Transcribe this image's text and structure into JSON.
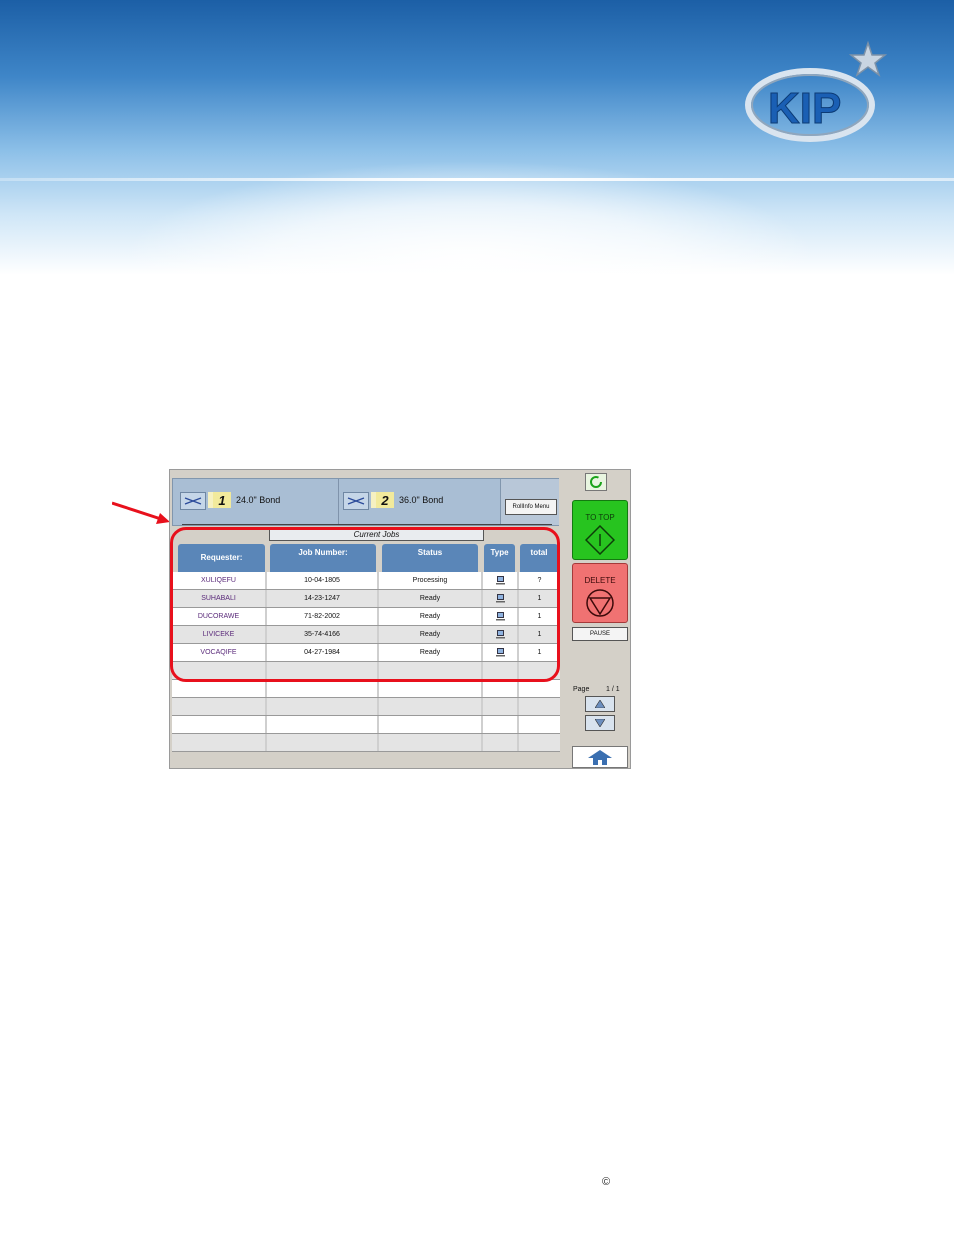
{
  "logo": {
    "text": "KIP"
  },
  "rolls": [
    {
      "number": "1",
      "label": "24.0\" Bond"
    },
    {
      "number": "2",
      "label": "36.0\" Bond"
    }
  ],
  "roll_info_label": "RollInfo Menu",
  "section_title": "Current Jobs",
  "columns": [
    "Requester:",
    "Job Number:",
    "Status",
    "Type",
    "total"
  ],
  "jobs": [
    {
      "requester": "XULIQEFU",
      "job_number": "10-04-1805",
      "status": "Processing",
      "type_icon": "computer-icon",
      "total": "?"
    },
    {
      "requester": "SUHABALI",
      "job_number": "14-23-1247",
      "status": "Ready",
      "type_icon": "computer-icon",
      "total": "1"
    },
    {
      "requester": "DUCORAWE",
      "job_number": "71-82-2002",
      "status": "Ready",
      "type_icon": "computer-icon",
      "total": "1"
    },
    {
      "requester": "LIVICEKE",
      "job_number": "35-74-4166",
      "status": "Ready",
      "type_icon": "computer-icon",
      "total": "1"
    },
    {
      "requester": "VOCAQIFE",
      "job_number": "04-27-1984",
      "status": "Ready",
      "type_icon": "computer-icon",
      "total": "1"
    }
  ],
  "side_panel": {
    "to_top_label": "TO TOP",
    "delete_label": "DELETE",
    "pause_label": "PAUSE",
    "page_label": "Page",
    "page_value": "1 / 1"
  },
  "footer": {
    "copyright": "©"
  },
  "colors": {
    "highlight_ring": "#e8101c",
    "to_top": "#27c41f",
    "delete": "#f07272",
    "header_blue": "#5a86b8"
  }
}
